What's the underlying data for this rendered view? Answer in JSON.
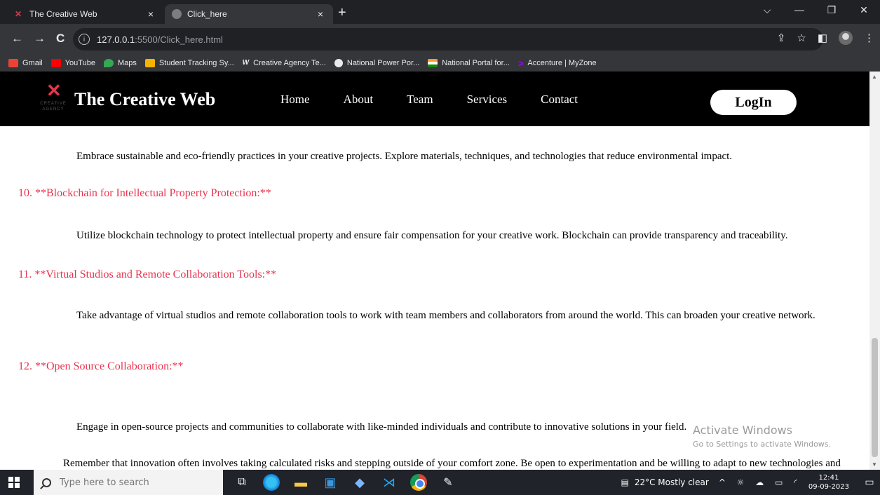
{
  "browser": {
    "tabs": [
      {
        "title": "The Creative Web",
        "close": "×"
      },
      {
        "title": "Click_here",
        "close": "×"
      }
    ],
    "new_tab": "+",
    "window_controls": {
      "dropdown": "⌵",
      "minimize": "—",
      "restore": "❐",
      "close": "✕"
    },
    "nav": {
      "back": "←",
      "forward": "→",
      "reload": "C"
    },
    "url_host": "127.0.0.1",
    "url_rest": ":5500/Click_here.html",
    "bookmarks": [
      {
        "label": "Gmail",
        "color": "#ea4335"
      },
      {
        "label": "YouTube",
        "color": "#ff0000"
      },
      {
        "label": "Maps",
        "color": "#34a853"
      },
      {
        "label": "Student Tracking Sy...",
        "color": "#f4b400"
      },
      {
        "label": "Creative Agency Te...",
        "color": "#e8eaed"
      },
      {
        "label": "National Power Por...",
        "color": "#e8eaed"
      },
      {
        "label": "National Portal for...",
        "color": "#ff9933"
      },
      {
        "label": "Accenture | MyZone",
        "color": "#a100ff"
      }
    ]
  },
  "site": {
    "logo_sub": "CREATIVE AGENCY",
    "brand": "The Creative Web",
    "nav": [
      "Home",
      "About",
      "Team",
      "Services",
      "Contact"
    ],
    "login": "LogIn",
    "accent": "#e8344e"
  },
  "content": {
    "p9": "Embrace sustainable and eco-friendly practices in your creative projects. Explore materials, techniques, and technologies that reduce environmental impact.",
    "h10": "10. **Blockchain for Intellectual Property Protection:**",
    "p10": "Utilize blockchain technology to protect intellectual property and ensure fair compensation for your creative work. Blockchain can provide transparency and traceability.",
    "h11": "11. **Virtual Studios and Remote Collaboration Tools:**",
    "p11": "Take advantage of virtual studios and remote collaboration tools to work with team members and collaborators from around the world. This can broaden your creative network.",
    "h12": "12. **Open Source Collaboration:**",
    "p12": "Engage in open-source projects and communities to collaborate with like-minded individuals and contribute to innovative solutions in your field.",
    "closing": "Remember that innovation often involves taking calculated risks and stepping outside of your comfort zone. Be open to experimentation and be willing to adapt to new technologies and trends as they emerge. By continuously seeking out innovative solutions, you can keep your creative projects fresh and engaging."
  },
  "watermark": {
    "line1": "Activate Windows",
    "line2": "Go to Settings to activate Windows."
  },
  "taskbar": {
    "search_placeholder": "Type here to search",
    "weather": "22°C  Mostly clear",
    "time": "12:41",
    "date": "09-09-2023"
  }
}
